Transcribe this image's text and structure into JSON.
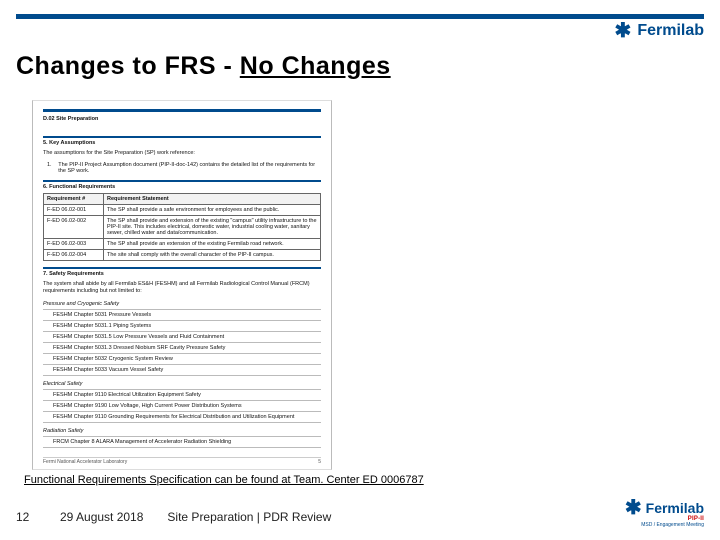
{
  "brand": {
    "name": "Fermilab"
  },
  "title": {
    "prefix": "Changes to FRS - ",
    "emph": "No Changes"
  },
  "thumb": {
    "doc_code": "D.02 Site Preparation",
    "sec5_head": "5.  Key Assumptions",
    "sec5_para": "The assumptions for the Site Preparation (SP) work reference:",
    "sec5_item1_n": "1.",
    "sec5_item1": "The PIP-II Project Assumption document (PIP-II-doc-142) contains the detailed list of the requirements for the SP work.",
    "sec6_head": "6.  Functional Requirements",
    "tbl_h1": "Requirement #",
    "tbl_h2": "Requirement Statement",
    "r1c1": "F-ED 06.02-001",
    "r1c2": "The SP shall provide a safe environment for employees and the public.",
    "r2c1": "F-ED 06.02-002",
    "r2c2": "The SP shall provide and extension of the existing \"campus\" utility infrastructure to the PIP-II site. This includes electrical, domestic water, industrial cooling water, sanitary sewer, chilled water and data/communication.",
    "r3c1": "F-ED 06.02-003",
    "r3c2": "The SP shall provide an extension of the existing Fermilab road network.",
    "r4c1": "F-ED 06.02-004",
    "r4c2": "The site shall comply with the overall character of the PIP-II campus.",
    "sec7_head": "7.  Safety Requirements",
    "sec7_para": "The system shall abide by all Fermilab ES&H (FESHM) and all Fermilab Radiological Control Manual (FRCM) requirements including but not limited to:",
    "sub_pressure": "Pressure and Cryogenic Safety",
    "p1": "FESHM Chapter 5031 Pressure Vessels",
    "p2": "FESHM Chapter 5031.1 Piping Systems",
    "p3": "FESHM Chapter 5031.5 Low Pressure Vessels and Fluid Containment",
    "p4": "FESHM Chapter 5031.3 Dressed Niobium SRF Cavity Pressure Safety",
    "p5": "FESHM Chapter 5032 Cryogenic System Review",
    "p6": "FESHM Chapter 5033 Vacuum Vessel Safety",
    "sub_elec": "Electrical Safety",
    "e1": "FESHM Chapter 9110 Electrical Utilization Equipment Safety",
    "e2": "FESHM Chapter 9190 Low Voltage, High Current Power Distribution Systems",
    "e3": "FESHM Chapter 9110 Grounding Requirements for Electrical Distribution and Utilization Equipment",
    "sub_rad": "Radiation Safety",
    "rad1": "FRCM Chapter 8 ALARA Management of Accelerator Radiation Shielding",
    "footer_left": "Fermi National Accelerator Laboratory",
    "footer_right": "5"
  },
  "note": "Functional Requirements Specification can be found at Team. Center ED 0006787",
  "footer": {
    "page": "12",
    "date": "29 August 2018",
    "context": "Site Preparation | PDR Review"
  },
  "bottom_logo": {
    "line2": "PIP-II",
    "line3": "MSD / Engagement Meeting"
  }
}
